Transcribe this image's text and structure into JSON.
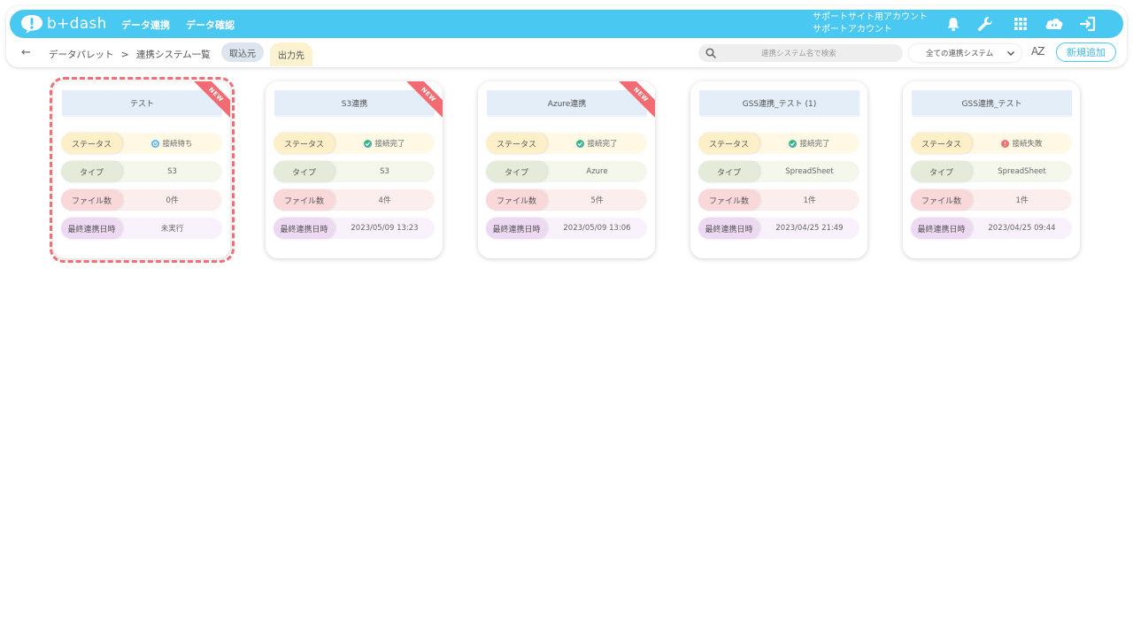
{
  "header": {
    "logo_text": "b+dash",
    "nav": [
      "データ連携",
      "データ確認"
    ],
    "account_line1": "サポートサイト用アカウント",
    "account_line2": "サポートアカウント"
  },
  "breadcrumb": {
    "parent": "データパレット",
    "separator": ">",
    "current": "連携システム一覧"
  },
  "tabs": {
    "source": "取込元",
    "output": "出力先"
  },
  "search": {
    "placeholder": "連携システム名で検索"
  },
  "filter": {
    "selected": "全ての連携システム"
  },
  "sort_label": "AZ",
  "add_button": "新規追加",
  "labels": {
    "status": "ステータス",
    "type": "タイプ",
    "file_count": "ファイル数",
    "last_sync": "最終連携日時",
    "new_badge": "NEW"
  },
  "cards": [
    {
      "title": "テスト",
      "status": "接続待ち",
      "status_kind": "waiting",
      "type": "S3",
      "file_count": "0件",
      "last_sync": "未実行",
      "is_new": true
    },
    {
      "title": "S3連携",
      "status": "接続完了",
      "status_kind": "success",
      "type": "S3",
      "file_count": "4件",
      "last_sync": "2023/05/09 13:23",
      "is_new": true
    },
    {
      "title": "Azure連携",
      "status": "接続完了",
      "status_kind": "success",
      "type": "Azure",
      "file_count": "5件",
      "last_sync": "2023/05/09 13:06",
      "is_new": true
    },
    {
      "title": "GSS連携_テスト (1)",
      "status": "接続完了",
      "status_kind": "success",
      "type": "SpreadSheet",
      "file_count": "1件",
      "last_sync": "2023/04/25 21:49",
      "is_new": false
    },
    {
      "title": "GSS連携_テスト",
      "status": "接続失敗",
      "status_kind": "error",
      "type": "SpreadSheet",
      "file_count": "1件",
      "last_sync": "2023/04/25 09:44",
      "is_new": false
    }
  ],
  "colors": {
    "brand": "#49c8f2",
    "success": "#3bb58e",
    "error": "#f07074",
    "waiting": "#5ab8e8",
    "highlight": "#f07074"
  }
}
